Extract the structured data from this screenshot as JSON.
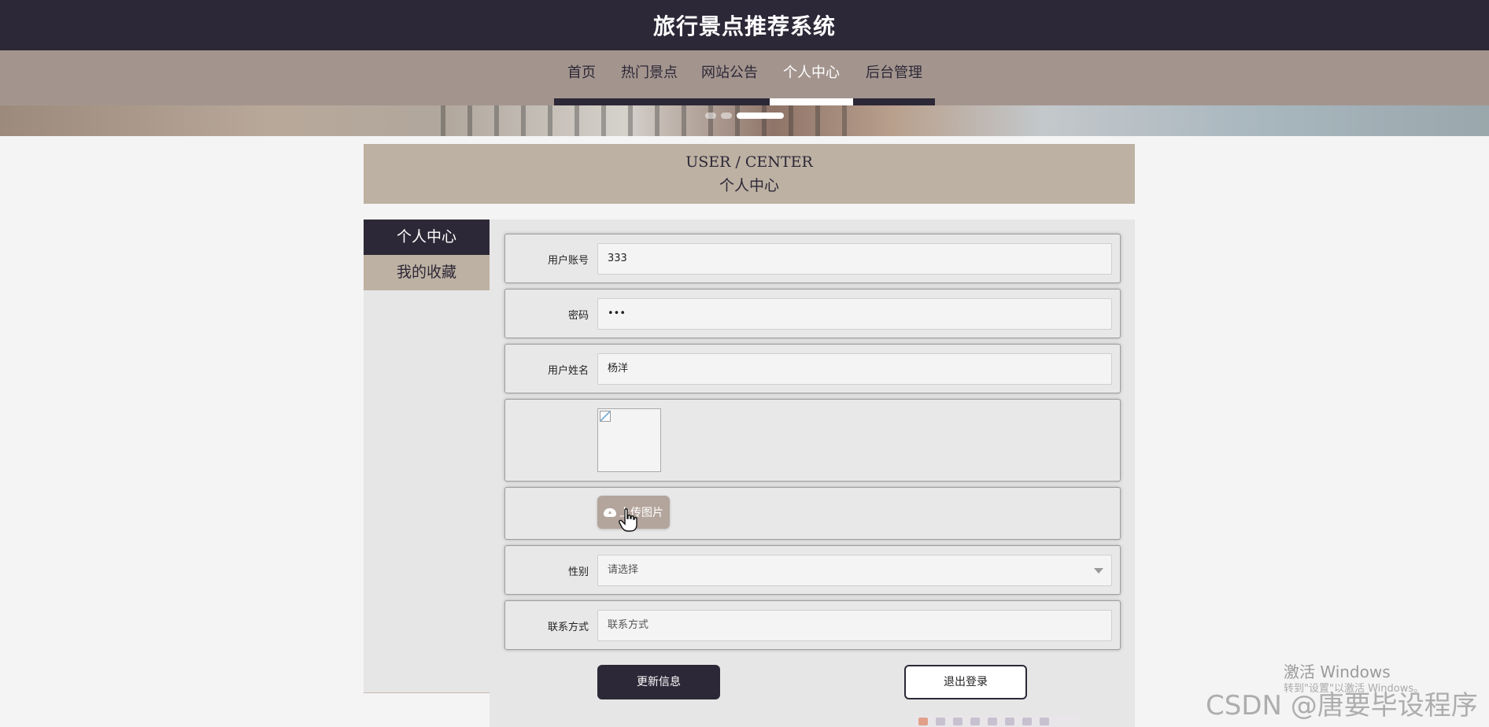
{
  "header": {
    "title": "旅行景点推荐系统"
  },
  "nav": {
    "items": [
      {
        "label": "首页",
        "active": false
      },
      {
        "label": "热门景点",
        "active": false
      },
      {
        "label": "网站公告",
        "active": false
      },
      {
        "label": "个人中心",
        "active": true
      },
      {
        "label": "后台管理",
        "active": false
      }
    ]
  },
  "banner": {
    "slide_count": 3,
    "active_slide": 3
  },
  "section": {
    "title_en": "USER / CENTER",
    "title_cn": "个人中心"
  },
  "sidebar": {
    "items": [
      {
        "label": "个人中心",
        "active": true
      },
      {
        "label": "我的收藏",
        "active": false
      }
    ]
  },
  "form": {
    "account": {
      "label": "用户账号",
      "value": "333"
    },
    "password": {
      "label": "密码",
      "value": "•••"
    },
    "name": {
      "label": "用户姓名",
      "value": "杨洋"
    },
    "avatar": {
      "label": ""
    },
    "upload": {
      "label": "上传图片"
    },
    "gender": {
      "label": "性别",
      "value": "请选择"
    },
    "contact": {
      "label": "联系方式",
      "placeholder": "联系方式"
    }
  },
  "buttons": {
    "update": "更新信息",
    "logout": "退出登录"
  },
  "watermarks": {
    "windows_line1": "激活 Windows",
    "windows_line2": "转到\"设置\"以激活 Windows。",
    "csdn": "CSDN @唐要毕设程序"
  },
  "colors": {
    "primary": "#2d2837",
    "nav_bg": "#a3958e",
    "accent": "#bdb1a3"
  }
}
